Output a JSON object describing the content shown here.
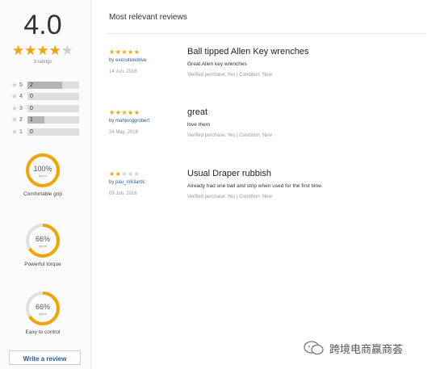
{
  "summary": {
    "average": "4.0",
    "average_stars": 4,
    "ratings_text": "3 ratings",
    "distribution": [
      {
        "stars": "5",
        "count": "2",
        "fraction": 0.67
      },
      {
        "stars": "4",
        "count": "0",
        "fraction": 0
      },
      {
        "stars": "3",
        "count": "0",
        "fraction": 0
      },
      {
        "stars": "2",
        "count": "1",
        "fraction": 0.33
      },
      {
        "stars": "1",
        "count": "0",
        "fraction": 0
      }
    ],
    "attributes": [
      {
        "percent": "100%",
        "sub": "agree",
        "label": "Comfortable grip",
        "value": 1.0
      },
      {
        "percent": "66%",
        "sub": "agree",
        "label": "Powerful torque",
        "value": 0.66
      },
      {
        "percent": "66%",
        "sub": "agree",
        "label": "Easy to control",
        "value": 0.66
      }
    ],
    "write_review_label": "Write a review"
  },
  "reviews_section": {
    "title": "Most relevant reviews",
    "reviews": [
      {
        "rating": 5,
        "by_prefix": "by",
        "user": "executivedrive",
        "date": "14 Jun, 2016",
        "title": "Ball tipped Allen Key wrenches",
        "body": "Great Allen key wrenches",
        "meta": "Verified purchase: Yes | Condition: New"
      },
      {
        "rating": 5,
        "by_prefix": "by",
        "user": "mahjonggrobert",
        "date": "24 May, 2016",
        "title": "great",
        "body": "love them",
        "meta": "Verified purchase: Yes | Condition: New"
      },
      {
        "rating": 2,
        "by_prefix": "by",
        "user": "pau_m63ardc",
        "date": "09 Jun, 2016",
        "title": "Usual Draper rubbish",
        "body": "Already had one ball and strip when used for the first time.",
        "meta": "Verified purchase: Yes | Condition: New"
      }
    ]
  },
  "watermark": {
    "text": "跨境电商赢商荟"
  },
  "colors": {
    "star": "#f0a500",
    "star_empty": "#cfcfcf",
    "gauge": "#f0a500",
    "gauge_track": "#e0e0e0",
    "link": "#2a5a9a"
  }
}
